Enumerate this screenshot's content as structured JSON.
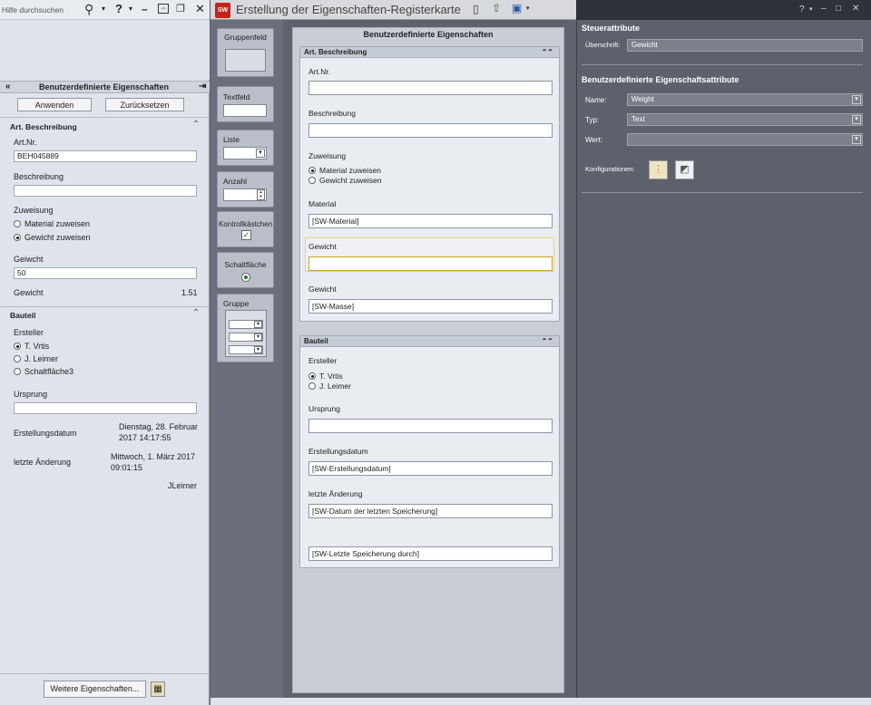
{
  "left": {
    "search_placeholder": "Hilfe durchsuchen",
    "panel_title": "Benutzerdefinierte Eigenschaften",
    "apply_label": "Anwenden",
    "reset_label": "Zurücksetzen",
    "sec1_title": "Art. Beschreibung",
    "artnr_label": "Art.Nr.",
    "artnr_value": "BEH045889",
    "beschreibung_label": "Beschreibung",
    "zuweisung_label": "Zuweisung",
    "radio_material": "Material zuweisen",
    "radio_gewicht": "Gewicht zuweisen",
    "geiwcht_label": "Geiwcht",
    "geiwcht_value": "50",
    "gewicht_label": "Gewicht",
    "gewicht_value": "1.51",
    "sec2_title": "Bauteil",
    "ersteller_label": "Ersteller",
    "ersteller_opts": [
      "T. Vrtis",
      "J. Leimer",
      "Schaltfläche3"
    ],
    "ursprung_label": "Ursprung",
    "erstdatum_label": "Erstellungsdatum",
    "erstdatum_value_1": "Dienstag, 28. Februar",
    "erstdatum_value_2": "2017 14:17:55",
    "letzte_label": "letzte Änderung",
    "letzte_value_1": "Mittwoch, 1. März 2017",
    "letzte_value_2": "09:01:15",
    "by_value": "JLeimer",
    "more_button": "Weitere Eigenschaften..."
  },
  "titlebar": {
    "title": "Erstellung der Eigenschaften-Registerkarte",
    "logo_text": "SW"
  },
  "palette": {
    "items": [
      "Gruppenfeld",
      "Textfeld",
      "Liste",
      "Anzahl",
      "Kontrollkästchen",
      "Schaltfläche",
      "Gruppe"
    ]
  },
  "form": {
    "title": "Benutzerdefinierte Eigenschaften",
    "g1_title": "Art. Beschreibung",
    "artnr_label": "Art.Nr.",
    "beschreibung_label": "Beschreibung",
    "zuweisung_label": "Zuweisung",
    "radio_material": "Material zuweisen",
    "radio_gewicht": "Gewicht zuweisen",
    "material_label": "Material",
    "material_value": "[SW-Material]",
    "gewicht1_label": "Gewicht",
    "gewicht2_label": "Gewicht",
    "gewicht2_value": "[SW-Masse]",
    "g2_title": "Bauteil",
    "ersteller_label": "Ersteller",
    "ersteller_opt1": "T. Vrtis",
    "ersteller_opt2": "J. Leimer",
    "ursprung_label": "Ursprung",
    "erstdatum_label": "Erstellungsdatum",
    "erstdatum_value": "[SW-Erstellungsdatum]",
    "letzte_label": "letzte Änderung",
    "letzte_value": "[SW-Datum der letzten Speicherung]",
    "by_value": "[SW-Letzte Speicherung durch]"
  },
  "right": {
    "steuer_title": "Steuerattribute",
    "ueberschrift_label": "Überschrift:",
    "ueberschrift_value": "Gewicht",
    "bea_title": "Benutzerdefinierte Eigenschaftsattribute",
    "name_label": "Name:",
    "name_value": "Weight",
    "typ_label": "Typ:",
    "typ_value": "Text",
    "wert_label": "Wert:",
    "wert_value": "",
    "konfig_label": "Konfigurationen:"
  }
}
